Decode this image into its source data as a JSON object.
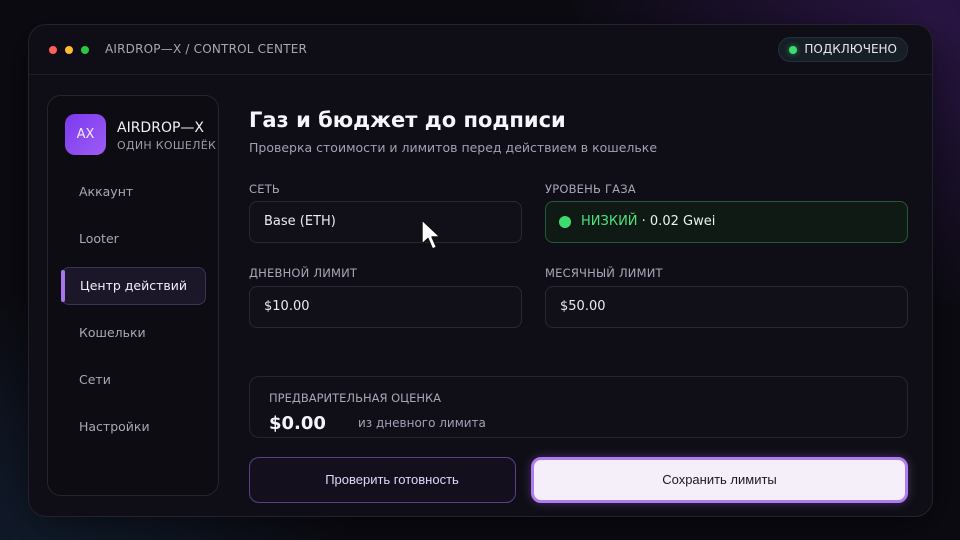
{
  "window": {
    "app_title": "AIRDROP—X / CONTROL CENTER",
    "connection_status": "ПОДКЛЮЧЕНО"
  },
  "sidebar": {
    "logo_text": "AX",
    "brand_name": "AIRDROP—X",
    "brand_subtitle": "ОДИН КОШЕЛЁК",
    "items": [
      {
        "label": "Аккаунт",
        "active": false
      },
      {
        "label": "Looter",
        "active": false
      },
      {
        "label": "Центр действий",
        "active": true
      },
      {
        "label": "Кошельки",
        "active": false
      },
      {
        "label": "Сети",
        "active": false
      },
      {
        "label": "Настройки",
        "active": false
      }
    ]
  },
  "main": {
    "title": "Газ и бюджет до подписи",
    "subtitle": "Проверка стоимости и лимитов перед действием в кошельке",
    "network": {
      "label": "СЕТЬ",
      "value": "Base (ETH)"
    },
    "gas": {
      "label": "УРОВЕНЬ ГАЗА",
      "level": "НИЗКИЙ",
      "price": " · 0.02 Gwei"
    },
    "daily_limit": {
      "label": "ДНЕВНОЙ ЛИМИТ",
      "value": "$10.00"
    },
    "monthly_limit": {
      "label": "МЕСЯЧНЫЙ ЛИМИТ",
      "value": "$50.00"
    },
    "estimate": {
      "label": "ПРЕДВАРИТЕЛЬНАЯ ОЦЕНКА",
      "value": "$0.00",
      "note": "из дневного лимита"
    },
    "check_button": "Проверить готовность",
    "save_button": "Сохранить лимиты"
  },
  "colors": {
    "accent": "#a874f0",
    "status_ok": "#3ddc6f",
    "background": "#0f0e16"
  },
  "icons": {
    "cursor": "pointer-cursor-icon",
    "status": "status-dot-icon"
  }
}
